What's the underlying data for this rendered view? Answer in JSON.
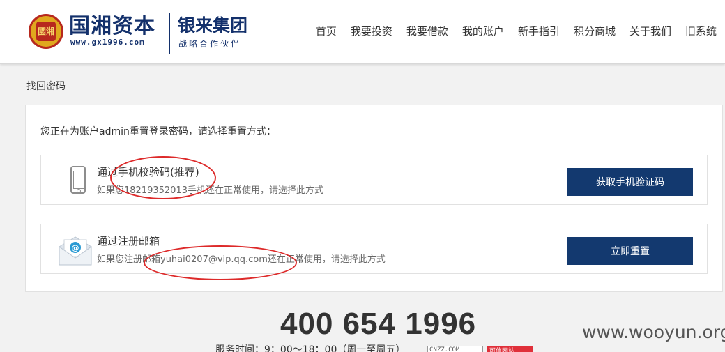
{
  "header": {
    "seal_text": "國湘",
    "brand_name": "国湘资本",
    "brand_url": "www.gx1996.com",
    "partner_name": "银来集团",
    "partner_tagline": "战略合作伙伴",
    "nav": [
      {
        "label": "首页",
        "icon": ""
      },
      {
        "label": "我要投资",
        "icon": ""
      },
      {
        "label": "我要借款",
        "icon": ""
      },
      {
        "label": "我的账户",
        "icon": ""
      },
      {
        "label": "新手指引",
        "icon": ""
      },
      {
        "label": "积分商城",
        "icon": ""
      },
      {
        "label": "关于我们",
        "icon": ""
      },
      {
        "label": "旧系统",
        "icon": ""
      }
    ]
  },
  "breadcrumb": "找回密码",
  "main": {
    "intro": "您正在为账户admin重置登录密码，请选择重置方式：",
    "options": [
      {
        "icon": "phone-icon",
        "title": "通过手机校验码(推荐)",
        "desc": "如果您18219352013手机还在正常使用，请选择此方式",
        "button": "获取手机验证码"
      },
      {
        "icon": "mail-icon",
        "title": "通过注册邮箱",
        "desc": "如果您注册邮箱yuhai0207@vip.qq.com还在正常使用，请选择此方式",
        "button": "立即重置"
      }
    ]
  },
  "footer": {
    "hotline": "400 654 1996",
    "service_hours": "服务时间：9：00～18：00（周一至周五）",
    "cnzz_badge": "CNZZ.COM",
    "red_badge": "可信网站"
  },
  "watermark": "www.wooyun.org",
  "colors": {
    "brand_blue": "#13396f",
    "annotation_red": "#dd2a2a",
    "seal_gold": "#e0a81e"
  }
}
